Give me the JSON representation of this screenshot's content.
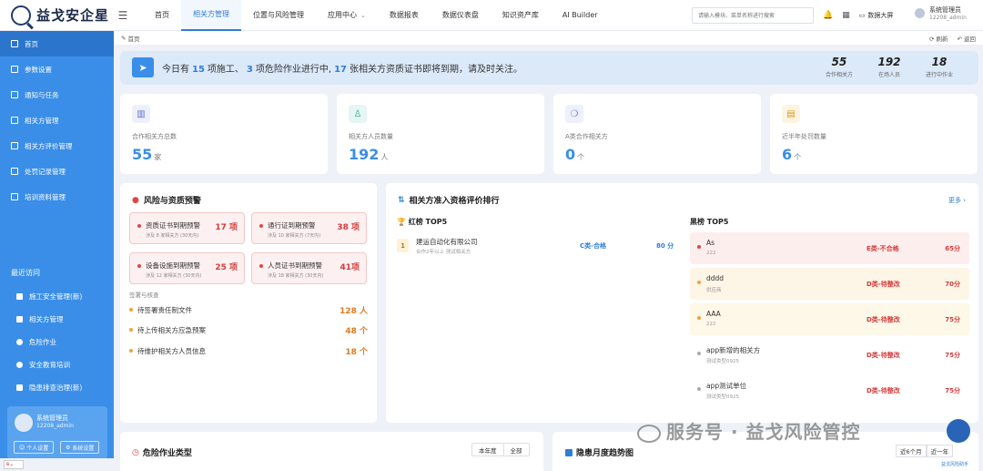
{
  "brand": {
    "name": "益戈安企星"
  },
  "nav": {
    "items": [
      {
        "label": "首页"
      },
      {
        "label": "相关方管理"
      },
      {
        "label": "位置与风险管理"
      },
      {
        "label": "应用中心"
      },
      {
        "label": "数据报表"
      },
      {
        "label": "数据仪表盘"
      },
      {
        "label": "知识资产库"
      },
      {
        "label": "AI Builder"
      }
    ]
  },
  "search": {
    "placeholder": "请输入模块、菜单名称进行搜索"
  },
  "header": {
    "bigscreen": "数据大屏",
    "user_name": "系统管理员",
    "user_id": "12208_admin"
  },
  "sidebar": {
    "items": [
      {
        "label": "首页"
      },
      {
        "label": "参数设置"
      },
      {
        "label": "通知与任务"
      },
      {
        "label": "相关方管理"
      },
      {
        "label": "相关方评价管理"
      },
      {
        "label": "处罚记录管理"
      },
      {
        "label": "培训资料管理"
      }
    ],
    "recent_title": "最近访问",
    "recent": [
      {
        "label": "施工安全管理(新)"
      },
      {
        "label": "相关方管理"
      },
      {
        "label": "危险作业"
      },
      {
        "label": "安全教育培训"
      },
      {
        "label": "隐患排查治理(新)"
      }
    ],
    "user": {
      "name": "系统管理员",
      "id": "12208_admin",
      "btn_personal": "个人设置",
      "btn_system": "系统设置"
    }
  },
  "breadcrumb": {
    "home": "首页",
    "refresh": "刷新",
    "back": "返回"
  },
  "notice": {
    "p1": "今日有",
    "n1": "15",
    "p2": "项施工、",
    "n2": "3",
    "p3": "项危险作业进行中,",
    "n3": "17",
    "p4": "张相关方资质证书即将到期，请及时关注。",
    "stats": [
      {
        "value": "55",
        "label": "合作相关方"
      },
      {
        "value": "192",
        "label": "在场人员"
      },
      {
        "value": "18",
        "label": "进行中作业"
      }
    ]
  },
  "kpis": [
    {
      "label": "合作相关方总数",
      "value": "55",
      "unit": "家",
      "icon": "building-icon",
      "color": "#5b6fd6",
      "bg": "#eef0fb"
    },
    {
      "label": "相关方人员数量",
      "value": "192",
      "unit": "人",
      "icon": "person-icon",
      "color": "#20a38a",
      "bg": "#e6f6f2"
    },
    {
      "label": "A类合作相关方",
      "value": "0",
      "unit": "个",
      "icon": "medal-icon",
      "color": "#5b6fd6",
      "bg": "#eef0fb"
    },
    {
      "label": "近半年处罚数量",
      "value": "6",
      "unit": "个",
      "icon": "document-icon",
      "color": "#d99a1f",
      "bg": "#fdf4e2"
    }
  ],
  "risk": {
    "title": "风险与资质预警",
    "alerts": [
      {
        "title": "资质证书到期预警",
        "sub": "涉及 8 家相关方 (30天内)",
        "count": "17 项"
      },
      {
        "title": "通行证到期预警",
        "sub": "涉及 10 家相关方 (7天内)",
        "count": "38 项"
      },
      {
        "title": "设备设施到期预警",
        "sub": "涉及 12 家相关方 (30天内)",
        "count": "25 项"
      },
      {
        "title": "人员证书到期预警",
        "sub": "涉及 18 家相关方 (30天内)",
        "count": "41项"
      }
    ],
    "todo_title": "签署与核查",
    "todos": [
      {
        "title": "待签署责任制文件",
        "count": "128 人"
      },
      {
        "title": "待上传相关方应急预案",
        "count": "48 个"
      },
      {
        "title": "待维护相关方人员信息",
        "count": "18 个"
      }
    ]
  },
  "ranking": {
    "title": "相关方准入资格评价排行",
    "more": "更多",
    "red_title": "红榜 TOP5",
    "red": [
      {
        "rank": "1",
        "name": "建运自动化有限公司",
        "sub": "合作2年以上 测试相关方",
        "grade": "C类-合格",
        "score": "80 分"
      }
    ],
    "black_title": "黑榜 TOP5",
    "black": [
      {
        "name": "As",
        "sub": "222",
        "grade": "E类-不合格",
        "score": "65分",
        "bg": "#fdeeee",
        "dot": "#e04545"
      },
      {
        "name": "dddd",
        "sub": "供应商",
        "grade": "D类-待整改",
        "score": "70分",
        "bg": "#fdf5e6",
        "dot": "#f0a23a"
      },
      {
        "name": "AAA",
        "sub": "222",
        "grade": "D类-待整改",
        "score": "75分",
        "bg": "#fdf8e8",
        "dot": "#f0a23a"
      },
      {
        "name": "app新增的相关方",
        "sub": "测试类型0925",
        "grade": "D类-待整改",
        "score": "75分",
        "bg": "#ffffff",
        "dot": "#aaaaaa"
      },
      {
        "name": "app测试单位",
        "sub": "测试类型0925",
        "grade": "D类-待整改",
        "score": "75分",
        "bg": "#ffffff",
        "dot": "#aaaaaa"
      }
    ]
  },
  "bottom": {
    "left_title": "危险作业类型",
    "seg": [
      "本年度",
      "全部"
    ],
    "right_title": "隐患月度趋势图",
    "range": [
      "近6个月",
      "近一年"
    ]
  },
  "watermark": {
    "text": "服务号 · 益戈风险管控",
    "robot_label": "益戈风险助手"
  }
}
